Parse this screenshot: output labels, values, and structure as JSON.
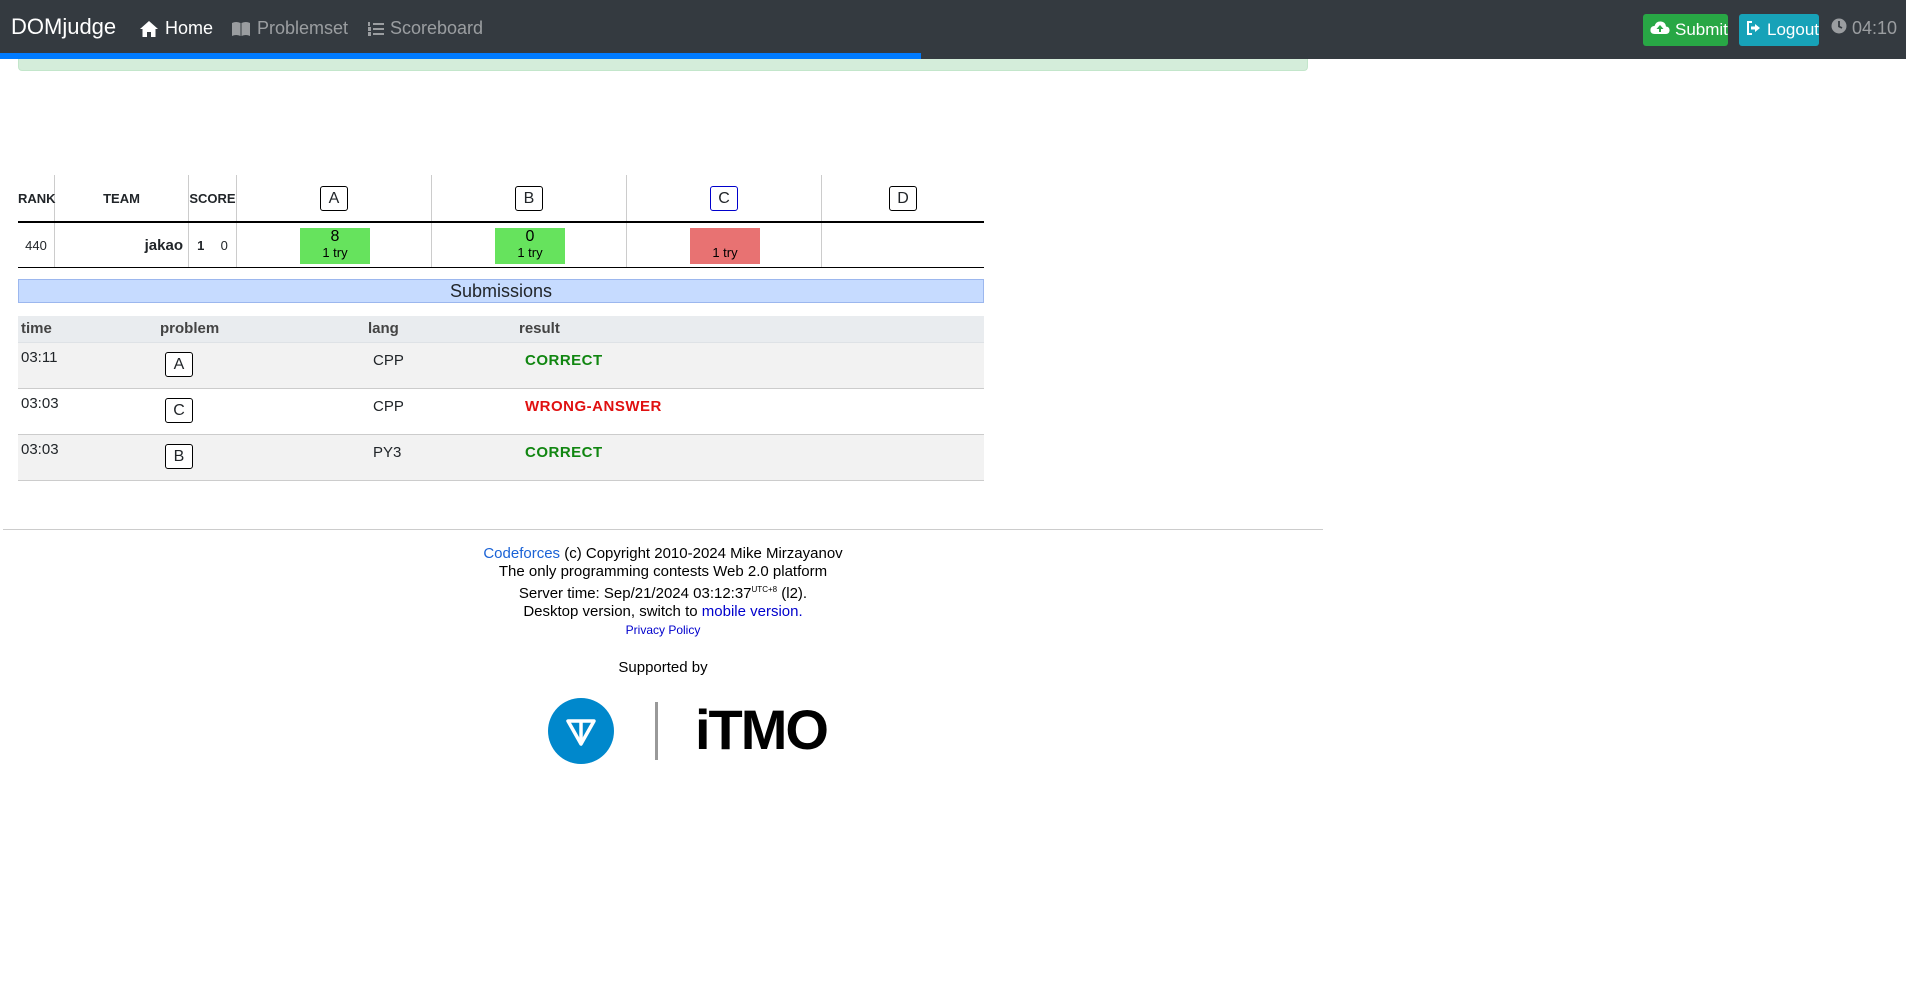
{
  "nav": {
    "brand": "DOMjudge",
    "home": "Home",
    "problemset": "Problemset",
    "scoreboard": "Scoreboard",
    "submit": "Submit",
    "logout": "Logout",
    "clock": "04:10",
    "contest_progress": 0.483,
    "colors": {
      "bar": "#343a40",
      "progress": "#007bff",
      "submit": "#28a745",
      "logout": "#17a2b8"
    }
  },
  "scoreboard": {
    "headers": {
      "rank": "RANK",
      "team": "TEAM",
      "score": "SCORE"
    },
    "problems": [
      "A",
      "B",
      "C",
      "D"
    ],
    "row": {
      "rank": "440",
      "team": "jakao",
      "solved": "1",
      "penalty": "0",
      "cells": [
        {
          "num": "8",
          "tries": "1 try",
          "status": "correct",
          "color": "#66e35d"
        },
        {
          "num": "0",
          "tries": "1 try",
          "status": "correct",
          "color": "#66e35d"
        },
        {
          "num": "",
          "tries": "1 try",
          "status": "incorrect",
          "color": "#e87272"
        },
        {
          "num": "",
          "tries": "",
          "status": "none",
          "color": ""
        }
      ]
    }
  },
  "submissions": {
    "title": "Submissions",
    "headers": {
      "time": "time",
      "problem": "problem",
      "lang": "lang",
      "result": "result"
    },
    "rows": [
      {
        "time": "03:11",
        "problem": "A",
        "lang": "CPP",
        "result": "CORRECT"
      },
      {
        "time": "03:03",
        "problem": "C",
        "lang": "CPP",
        "result": "WRONG-ANSWER"
      },
      {
        "time": "03:03",
        "problem": "B",
        "lang": "PY3",
        "result": "CORRECT"
      }
    ]
  },
  "footer": {
    "codeforces": "Codeforces",
    "copyright": "(c) Copyright 2010-2024 Mike Mirzayanov",
    "tagline": "The only programming contests Web 2.0 platform",
    "server_time_label": "Server time: Sep/21/2024 03:12:37",
    "tz": "UTC+8",
    "server_suffix": "(l2).",
    "desktop_text": "Desktop version, switch to",
    "mobile_link": "mobile version",
    "privacy": "Privacy Policy",
    "supported_by": "Supported by",
    "itmo": "iTMO"
  }
}
